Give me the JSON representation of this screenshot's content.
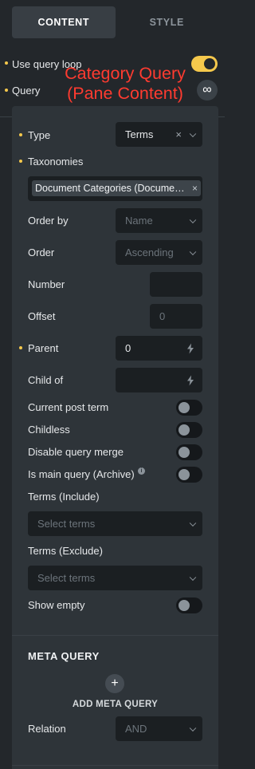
{
  "tabs": [
    {
      "label": "CONTENT",
      "active": true
    },
    {
      "label": "STYLE",
      "active": false
    }
  ],
  "query_loop": {
    "label": "Use query loop",
    "enabled": true
  },
  "query": {
    "label": "Query",
    "button_icon": "infinity-icon",
    "button_glyph": "∞"
  },
  "annotation": {
    "line1": "Category Query",
    "line2": "(Pane Content)"
  },
  "fields": {
    "type": {
      "label": "Type",
      "value": "Terms",
      "clear": "×"
    },
    "taxonomies": {
      "label": "Taxonomies",
      "chip": "Document Categories (Documents)",
      "chip_remove": "×"
    },
    "order_by": {
      "label": "Order by",
      "placeholder": "Name"
    },
    "order": {
      "label": "Order",
      "placeholder": "Ascending"
    },
    "number": {
      "label": "Number",
      "value": ""
    },
    "offset": {
      "label": "Offset",
      "placeholder": "0"
    },
    "parent": {
      "label": "Parent",
      "value": "0"
    },
    "child_of": {
      "label": "Child of",
      "value": ""
    },
    "current_post_term": {
      "label": "Current post term",
      "enabled": false
    },
    "childless": {
      "label": "Childless",
      "enabled": false
    },
    "disable_query_merge": {
      "label": "Disable query merge",
      "enabled": false
    },
    "is_main_query": {
      "label": "Is main query (Archive)",
      "info": "i",
      "enabled": false
    },
    "terms_include": {
      "label": "Terms (Include)",
      "placeholder": "Select terms"
    },
    "terms_exclude": {
      "label": "Terms (Exclude)",
      "placeholder": "Select terms"
    },
    "show_empty": {
      "label": "Show empty",
      "enabled": false
    }
  },
  "meta_query": {
    "heading": "META QUERY",
    "add_label": "ADD META QUERY",
    "add_glyph": "+",
    "relation": {
      "label": "Relation",
      "placeholder": "AND"
    }
  },
  "colors": {
    "accent": "#f5c84c",
    "annotation": "#ff3b30",
    "panel": "#2e3439",
    "background": "#23272b"
  }
}
